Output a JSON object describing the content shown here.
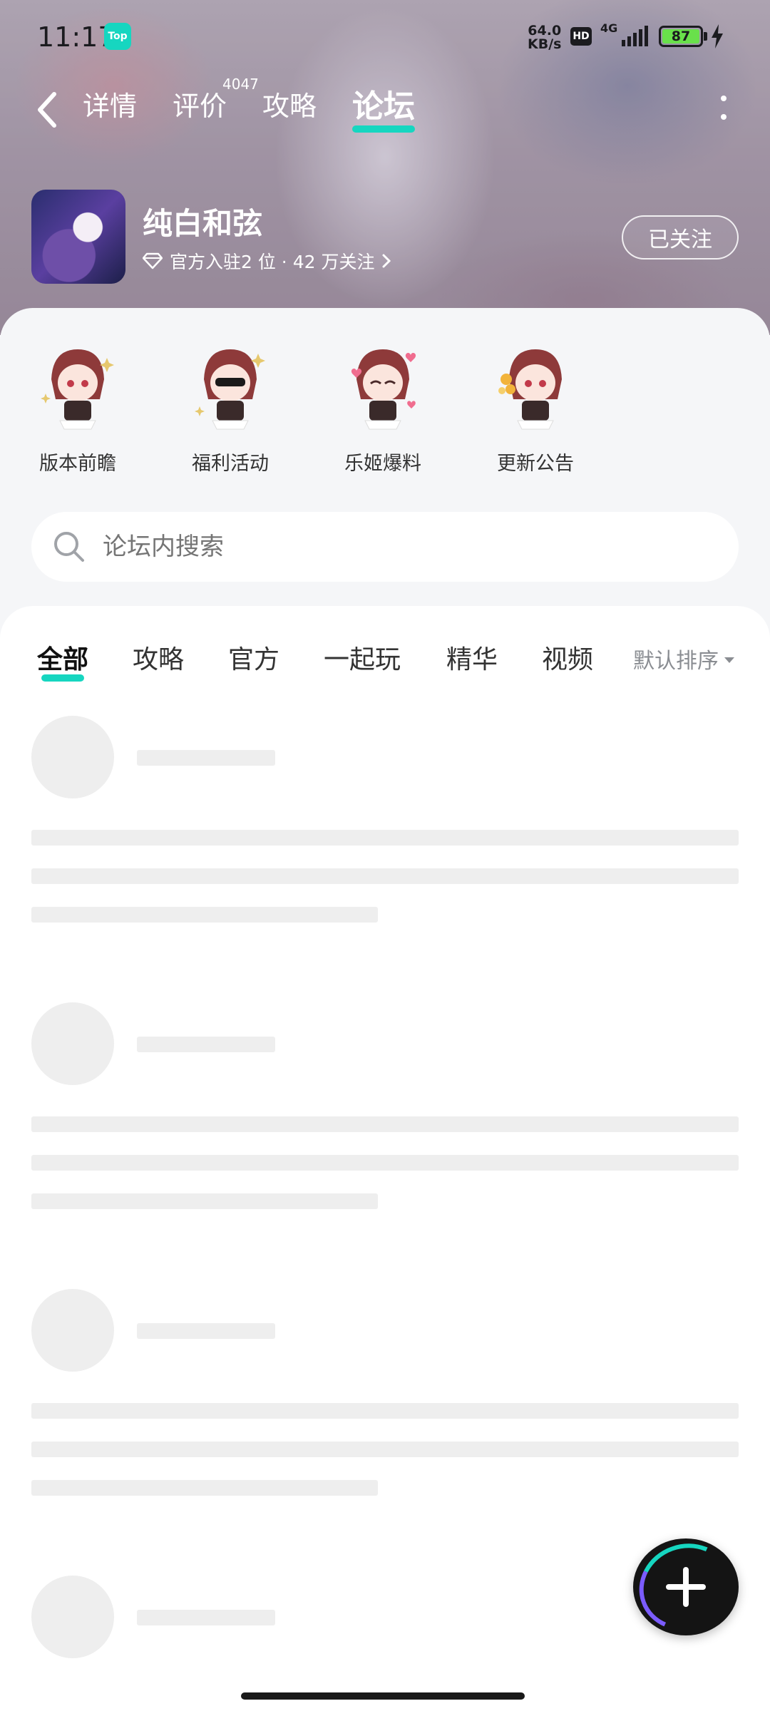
{
  "status_bar": {
    "time": "11:17",
    "app_badge": "Top",
    "net_speed_value": "64.0",
    "net_speed_unit": "KB/s",
    "hd_label": "HD",
    "network": "4G",
    "battery": "87"
  },
  "nav": {
    "tabs": [
      {
        "label": "详情"
      },
      {
        "label": "评价",
        "badge": "4047"
      },
      {
        "label": "攻略"
      },
      {
        "label": "论坛",
        "active": true
      }
    ]
  },
  "game": {
    "title": "纯白和弦",
    "stats": "官方入驻2 位 · 42 万关注",
    "follow_label": "已关注"
  },
  "quick_links": [
    {
      "label": "版本前瞻"
    },
    {
      "label": "福利活动"
    },
    {
      "label": "乐姬爆料"
    },
    {
      "label": "更新公告"
    }
  ],
  "search": {
    "placeholder": "论坛内搜索"
  },
  "filter_tabs": [
    {
      "label": "全部",
      "active": true
    },
    {
      "label": "攻略"
    },
    {
      "label": "官方"
    },
    {
      "label": "一起玩"
    },
    {
      "label": "精华"
    },
    {
      "label": "视频"
    }
  ],
  "sort": {
    "label": "默认排序"
  },
  "colors": {
    "accent": "#16d6c0",
    "skeleton": "#eeeeee",
    "battery": "#69e04b"
  }
}
